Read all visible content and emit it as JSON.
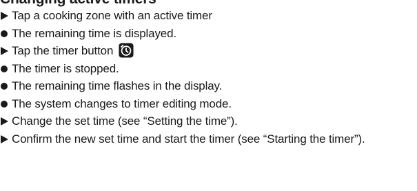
{
  "heading": "Changing active timers",
  "steps": [
    {
      "type": "action",
      "text": "Tap a cooking zone with an active timer"
    },
    {
      "type": "result",
      "text": "The remaining time is displayed."
    },
    {
      "type": "action",
      "text": "Tap the timer button",
      "icon": "timer-icon"
    },
    {
      "type": "result",
      "text": "The timer is stopped."
    },
    {
      "type": "result",
      "text": "The remaining time flashes in the display."
    },
    {
      "type": "result",
      "text": "The system changes to timer editing mode."
    },
    {
      "type": "action",
      "text": "Change the set time (see “Setting the time”)."
    },
    {
      "type": "action",
      "text": "Confirm the new set time and start the timer (see “Starting the timer”)."
    }
  ]
}
